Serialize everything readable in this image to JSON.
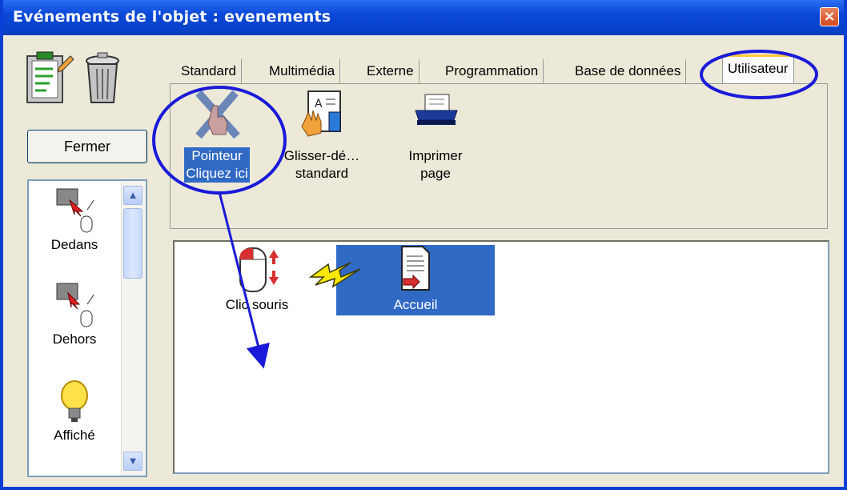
{
  "window": {
    "title": "Evénements de l'objet : evenements",
    "close_glyph": "×"
  },
  "toolbar": {
    "notes_icon": "clipboard-pencil-icon",
    "trash_icon": "trash-can-icon"
  },
  "fermer_label": "Fermer",
  "left_list": {
    "items": [
      {
        "label": "Dedans",
        "icon": "mouse-enter-icon"
      },
      {
        "label": "Dehors",
        "icon": "mouse-leave-icon"
      },
      {
        "label": "Affiché",
        "icon": "lightbulb-icon"
      }
    ]
  },
  "tabs": [
    {
      "label": "Standard",
      "active": false
    },
    {
      "label": "Multimédia",
      "active": false
    },
    {
      "label": "Externe",
      "active": false
    },
    {
      "label": "Programmation",
      "active": false
    },
    {
      "label": "Base de données",
      "active": false
    },
    {
      "label": "Utilisateur",
      "active": true
    }
  ],
  "palette": {
    "items": [
      {
        "line1": "Pointeur",
        "line2": "Cliquez ici",
        "icon": "pointer-hand-icon",
        "selected": true
      },
      {
        "line1": "Glisser-dé…",
        "line2": "standard",
        "icon": "drag-drop-hand-icon",
        "selected": false
      },
      {
        "line1": "Imprimer",
        "line2": "page",
        "icon": "printer-icon",
        "selected": false
      }
    ]
  },
  "canvas": {
    "trigger_label": "Clic souris",
    "action_label": "Accueil",
    "trigger_icon": "mouse-click-icon",
    "link_icon": "lightning-bolt-icon",
    "action_icon": "document-arrow-icon"
  },
  "colors": {
    "title_bar": "#0a48d8",
    "selection": "#316ac5",
    "annotation": "#1a1ad8",
    "active_tab_accent": "#ffc83c"
  }
}
